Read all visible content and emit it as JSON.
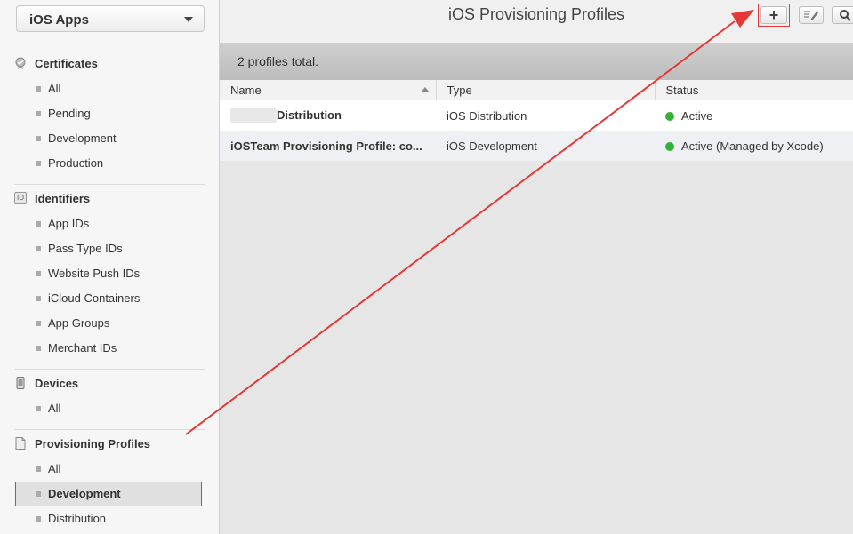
{
  "app_selector": {
    "label": "iOS Apps"
  },
  "sidebar": {
    "certificates": {
      "title": "Certificates",
      "items": [
        "All",
        "Pending",
        "Development",
        "Production"
      ]
    },
    "identifiers": {
      "title": "Identifiers",
      "badge": "ID",
      "items": [
        "App IDs",
        "Pass Type IDs",
        "Website Push IDs",
        "iCloud Containers",
        "App Groups",
        "Merchant IDs"
      ]
    },
    "devices": {
      "title": "Devices",
      "items": [
        "All"
      ]
    },
    "provisioning": {
      "title": "Provisioning Profiles",
      "items": [
        "All",
        "Development",
        "Distribution"
      ],
      "selected": "Development"
    }
  },
  "header": {
    "title": "iOS Provisioning Profiles",
    "add_label": "+"
  },
  "summary": "2 profiles total.",
  "table": {
    "columns": [
      "Name",
      "Type",
      "Status"
    ],
    "rows": [
      {
        "name": "Distribution",
        "type": "iOS Distribution",
        "status": "Active"
      },
      {
        "name": "iOSTeam Provisioning Profile: co...",
        "type": "iOS Development",
        "status": "Active (Managed by Xcode)"
      }
    ]
  },
  "colors": {
    "annotation": "#e53935",
    "status_active": "#34b233"
  }
}
